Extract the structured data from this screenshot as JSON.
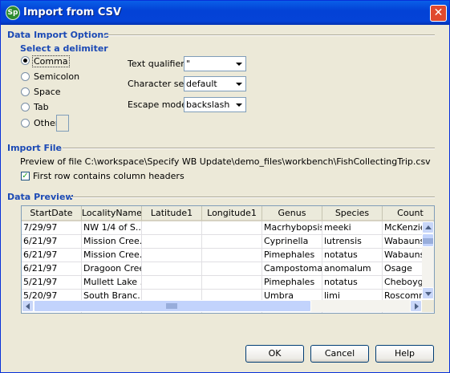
{
  "window": {
    "title": "Import from CSV",
    "app_icon_text": "Sp"
  },
  "options": {
    "section_title": "Data Import Options",
    "delimiter_title": "Select a delimiter",
    "delimiters": [
      "Comma",
      "Semicolon",
      "Space",
      "Tab",
      "Other"
    ],
    "selected_delimiter": "Comma",
    "other_value": "",
    "text_qualifier_label": "Text qualifier",
    "text_qualifier_value": "\"",
    "charset_label": "Character set",
    "charset_value": "default",
    "escape_label": "Escape mode",
    "escape_value": "backslash"
  },
  "import_file": {
    "section_title": "Import File",
    "preview_text": "Preview of file C:\\workspace\\Specify WB Update\\demo_files\\workbench\\FishCollectingTrip.csv",
    "header_checkbox_label": "First row contains column headers",
    "header_checked": true
  },
  "preview": {
    "section_title": "Data Preview",
    "columns": [
      "StartDate",
      "LocalityName",
      "Latitude1",
      "Longitude1",
      "Genus",
      "Species",
      "Count"
    ],
    "rows": [
      [
        "7/29/97",
        "NW 1/4 of S...",
        "",
        "",
        "Macrhybopsis",
        "meeki",
        "McKenzie"
      ],
      [
        "6/21/97",
        "Mission Cree...",
        "",
        "",
        "Cyprinella",
        "lutrensis",
        "Wabaunse"
      ],
      [
        "6/21/97",
        "Mission Cree...",
        "",
        "",
        "Pimephales",
        "notatus",
        "Wabaunse"
      ],
      [
        "6/21/97",
        "Dragoon Creek",
        "",
        "",
        "Campostoma",
        "anomalum",
        "Osage"
      ],
      [
        "5/21/97",
        "Mullett Lake ...",
        "",
        "",
        "Pimephales",
        "notatus",
        "Cheboyga"
      ],
      [
        "5/20/97",
        "South Branc...",
        "",
        "",
        "Umbra",
        "limi",
        "Roscommo"
      ],
      [
        "",
        "",
        "",
        "",
        "",
        "",
        ""
      ]
    ]
  },
  "buttons": {
    "ok": "OK",
    "cancel": "Cancel",
    "help": "Help"
  }
}
